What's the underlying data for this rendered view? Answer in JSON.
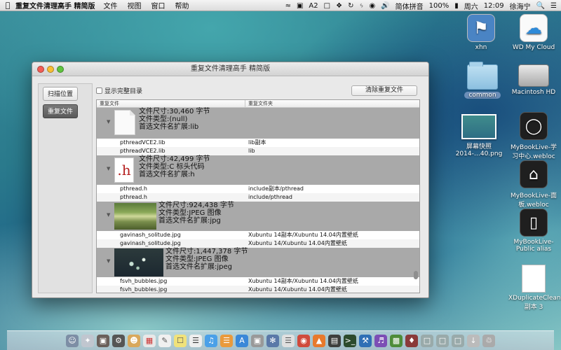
{
  "menubar": {
    "apple_icon": "apple-icon",
    "app_name": "重复文件清理高手 精简版",
    "menus": [
      "文件",
      "视图",
      "窗口",
      "帮助"
    ],
    "status": {
      "ime": "简体拼音",
      "battery": "100%",
      "day": "周六",
      "time": "12:09",
      "user": "徐海宁",
      "notif_count": "2"
    }
  },
  "desktop_icons": [
    {
      "label": "xhn"
    },
    {
      "label": "WD My Cloud"
    },
    {
      "label": "common"
    },
    {
      "label": "Macintosh HD"
    },
    {
      "label": "屏幕快照\n2014-…40.png"
    },
    {
      "label": "MyBookLive-学习中心.webloc"
    },
    {
      "label": "MyBookLive-面板.webloc"
    },
    {
      "label": "MyBookLive-Public alias"
    },
    {
      "label": "XDuplicateCleaner副本 3"
    }
  ],
  "window": {
    "title": "重复文件清理高手 精简版",
    "sidebar": {
      "scan_label": "扫描位置",
      "dup_label": "重复文件"
    },
    "show_full_dir_label": "显示完整目录",
    "clear_button_label": "清除重复文件",
    "columns": {
      "file": "重复文件",
      "folder": "重复文件夹"
    },
    "groups": [
      {
        "size": "文件尺寸:30,460 字节",
        "type": "文件类型:(null)",
        "ext": "首选文件名扩展:lib",
        "files": [
          {
            "name": "pthreadVCE2.lib",
            "folder": "lib副本"
          },
          {
            "name": "pthreadVCE2.lib",
            "folder": "lib"
          }
        ]
      },
      {
        "size": "文件尺寸:42,499 字节",
        "type": "文件类型:C 标头代码",
        "ext": "首选文件名扩展:h",
        "thumb_text": ".h",
        "files": [
          {
            "name": "pthread.h",
            "folder": "include副本/pthread"
          },
          {
            "name": "pthread.h",
            "folder": "include/pthread"
          }
        ]
      },
      {
        "size": "文件尺寸:924,438 字节",
        "type": "文件类型:JPEG 图像",
        "ext": "首选文件名扩展:jpg",
        "files": [
          {
            "name": "gavinash_solitude.jpg",
            "folder": "Xubuntu 14副本/Xubuntu 14.04内置壁纸"
          },
          {
            "name": "gavinash_solitude.jpg",
            "folder": "Xubuntu 14/Xubuntu 14.04内置壁纸"
          }
        ]
      },
      {
        "size": "文件尺寸:1,447,378 字节",
        "type": "文件类型:JPEG 图像",
        "ext": "首选文件名扩展:jpeg",
        "files": [
          {
            "name": "fsvh_bubbles.jpg",
            "folder": "Xubuntu 14副本/Xubuntu 14.04内置壁纸"
          },
          {
            "name": "fsvh_bubbles.jpg",
            "folder": "Xubuntu 14/Xubuntu 14.04内置壁纸"
          }
        ]
      }
    ]
  }
}
